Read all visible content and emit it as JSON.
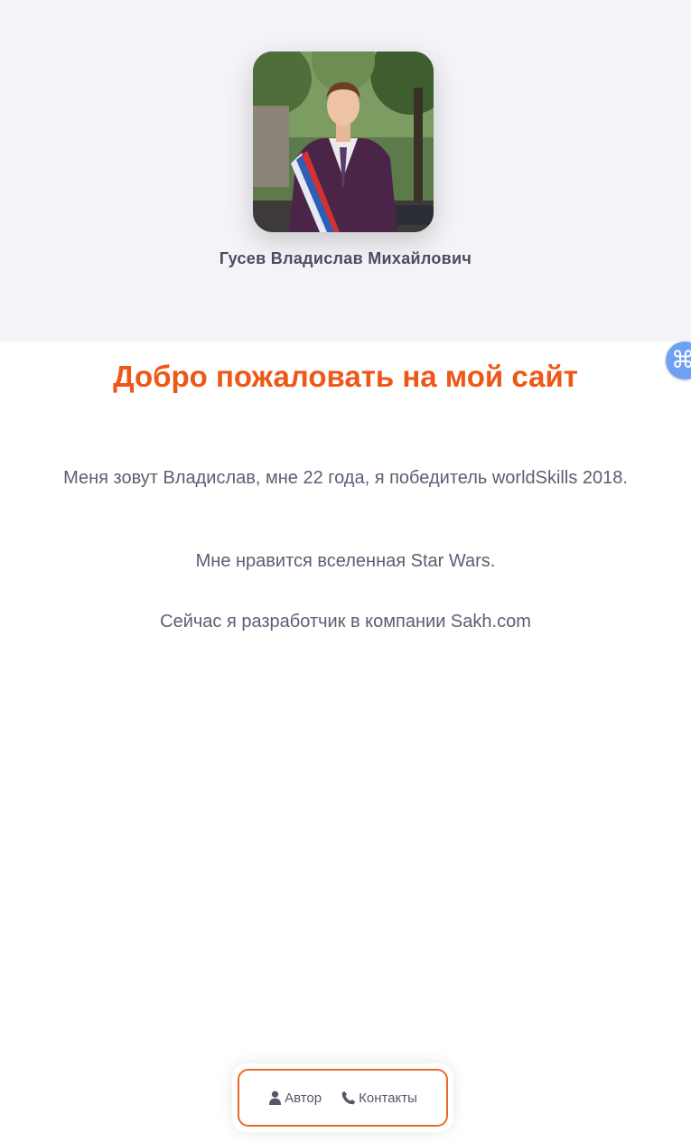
{
  "profile": {
    "name": "Гусев Владислав Михайлович"
  },
  "welcome": {
    "title": "Добро пожаловать на мой сайт"
  },
  "about": {
    "paragraphs": [
      "Меня зовут Владислав, мне 22 года, я победитель worldSkills 2018.",
      "Мне нравится вселенная Star Wars.",
      "Сейчас я разработчик в компании Sakh.com"
    ]
  },
  "badge": {
    "symbol": "⌘",
    "icon": "command-icon"
  },
  "nav": {
    "items": [
      {
        "label": "Автор",
        "icon": "user-icon"
      },
      {
        "label": "Контакты",
        "icon": "phone-icon"
      }
    ]
  },
  "colors": {
    "accent": "#ef5716",
    "nav_border": "#e86a2a",
    "hero_background": "#f4f4f8",
    "text": "#5c5e72",
    "badge": "#6ea2f0"
  }
}
